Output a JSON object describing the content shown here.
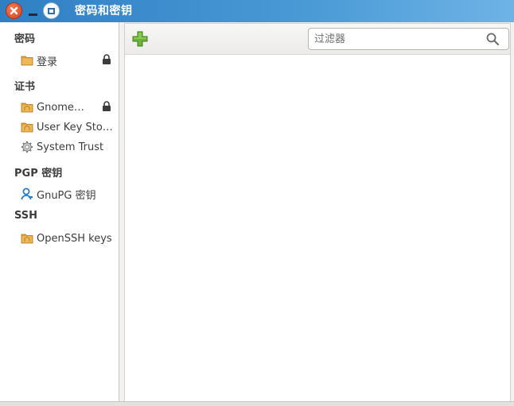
{
  "window": {
    "title": "密码和密钥"
  },
  "sidebar": {
    "sections": [
      {
        "heading": "密码",
        "items": [
          {
            "label": "登录",
            "icon": "folder-icon",
            "locked": true
          }
        ]
      },
      {
        "heading": "证书",
        "items": [
          {
            "label": "Gnome…",
            "icon": "folder-icon",
            "locked": true
          },
          {
            "label": "User Key Sto…",
            "icon": "folder-icon",
            "locked": false
          },
          {
            "label": "System Trust",
            "icon": "gear-icon",
            "locked": false
          }
        ]
      },
      {
        "heading": "PGP 密钥",
        "items": [
          {
            "label": "GnuPG 密钥",
            "icon": "person-key-icon",
            "locked": false
          }
        ]
      },
      {
        "heading": "SSH",
        "items": [
          {
            "label": "OpenSSH keys",
            "icon": "folder-icon",
            "locked": false
          }
        ]
      }
    ]
  },
  "toolbar": {
    "add_icon": "plus-icon",
    "search_placeholder": "过滤器",
    "search_icon": "search-icon"
  },
  "colors": {
    "titlebar": "#2f7fc4",
    "folder": "#e2a23e",
    "add": "#5aa62a"
  }
}
